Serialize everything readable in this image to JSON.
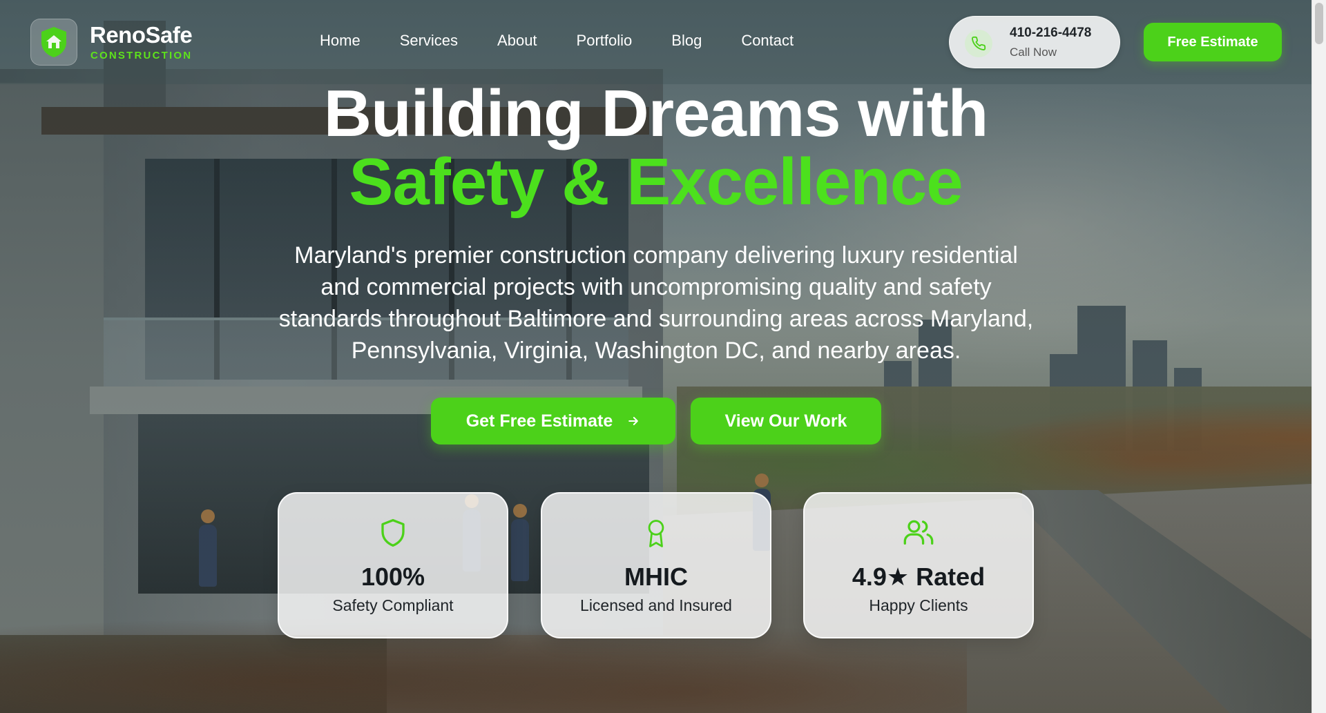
{
  "brand": {
    "name": "RenoSafe",
    "tagline": "CONSTRUCTION",
    "accent": "#4cd11a"
  },
  "nav": {
    "items": [
      {
        "label": "Home"
      },
      {
        "label": "Services"
      },
      {
        "label": "About"
      },
      {
        "label": "Portfolio"
      },
      {
        "label": "Blog"
      },
      {
        "label": "Contact"
      }
    ]
  },
  "contact": {
    "phone": "410-216-4478",
    "call_label": "Call Now",
    "icon": "phone-icon"
  },
  "header_cta": {
    "label": "Free Estimate"
  },
  "hero": {
    "title_line1": "Building Dreams with",
    "title_line2": "Safety & Excellence",
    "description": "Maryland's premier construction company delivering luxury residential and commercial projects with uncompromising quality and safety standards throughout Baltimore and surrounding areas across Maryland, Pennsylvania, Virginia, Washington DC, and nearby areas.",
    "primary_cta": "Get Free Estimate",
    "primary_cta_icon": "arrow-right-icon",
    "secondary_cta": "View Our Work"
  },
  "stats": [
    {
      "icon": "shield-icon",
      "value": "100%",
      "label": "Safety Compliant"
    },
    {
      "icon": "award-icon",
      "value": "MHIC",
      "label": "Licensed and Insured"
    },
    {
      "icon": "users-icon",
      "value": "4.9★ Rated",
      "label": "Happy Clients"
    }
  ]
}
